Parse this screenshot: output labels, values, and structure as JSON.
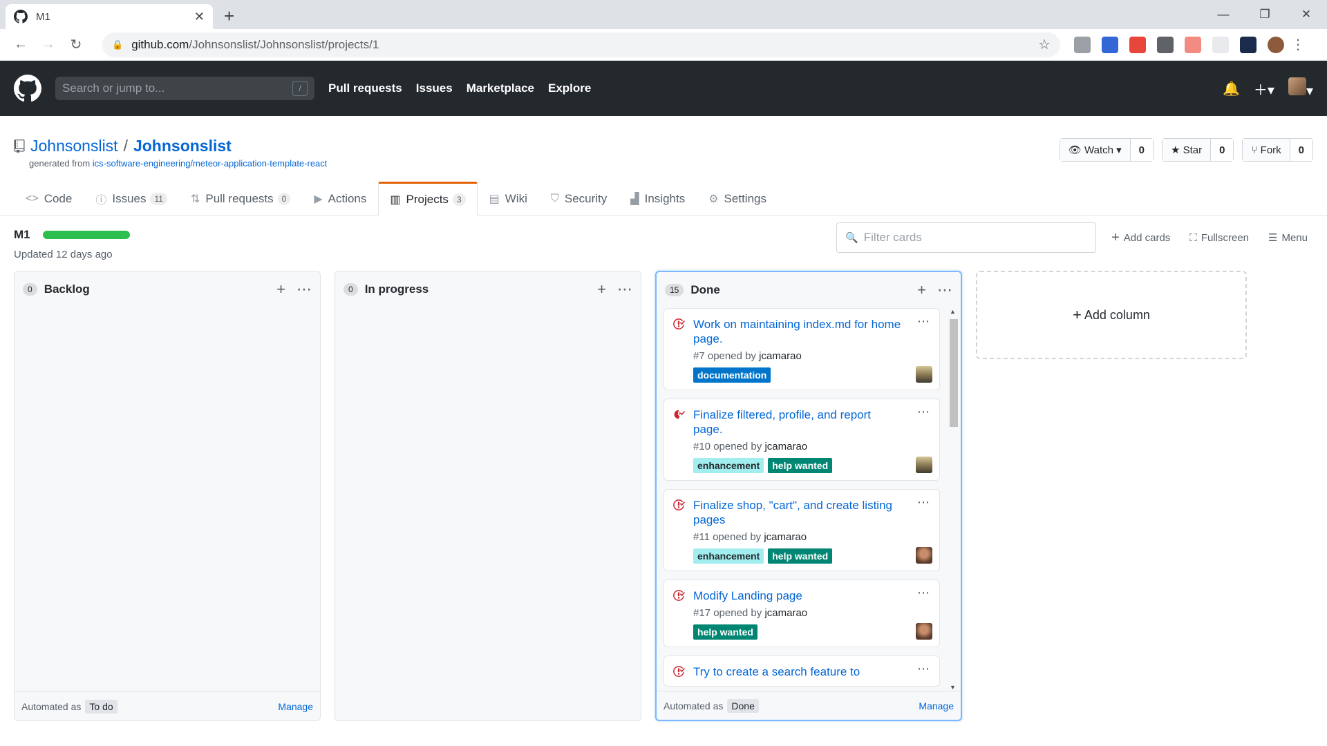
{
  "browser": {
    "tab_title": "M1",
    "url_host": "github.com",
    "url_path": "/Johnsonslist/Johnsonslist/projects/1"
  },
  "gh_header": {
    "search_placeholder": "Search or jump to...",
    "slash_key": "/",
    "nav": [
      "Pull requests",
      "Issues",
      "Marketplace",
      "Explore"
    ]
  },
  "repo": {
    "owner": "Johnsonslist",
    "separator": "/",
    "name": "Johnsonslist",
    "generated_prefix": "generated from",
    "generated_link": "ics-software-engineering/meteor-application-template-react",
    "watch_label": "Watch",
    "watch_count": "0",
    "star_label": "Star",
    "star_count": "0",
    "fork_label": "Fork",
    "fork_count": "0"
  },
  "reponav": {
    "code": "Code",
    "issues": "Issues",
    "issues_count": "11",
    "pulls": "Pull requests",
    "pulls_count": "0",
    "actions": "Actions",
    "projects": "Projects",
    "projects_count": "3",
    "wiki": "Wiki",
    "security": "Security",
    "insights": "Insights",
    "settings": "Settings"
  },
  "project": {
    "name": "M1",
    "progress_fraction": 1.0,
    "updated": "Updated 12 days ago",
    "filter_placeholder": "Filter cards",
    "add_cards": "Add cards",
    "fullscreen": "Fullscreen",
    "menu": "Menu",
    "add_column": "Add column"
  },
  "columns": {
    "backlog": {
      "count": "0",
      "name": "Backlog",
      "automated_as": "Automated as",
      "automation": "To do",
      "manage": "Manage"
    },
    "progress": {
      "count": "0",
      "name": "In progress"
    },
    "done": {
      "count": "15",
      "name": "Done",
      "automated_as": "Automated as",
      "automation": "Done",
      "manage": "Manage"
    }
  },
  "cards": [
    {
      "title": "Work on maintaining index.md for home page.",
      "number": "#7",
      "opened_by": "opened by",
      "user": "jcamarao",
      "labels": [
        "documentation"
      ]
    },
    {
      "title": "Finalize filtered, profile, and report page.",
      "number": "#10",
      "opened_by": "opened by",
      "user": "jcamarao",
      "labels": [
        "enhancement",
        "help wanted"
      ]
    },
    {
      "title": "Finalize shop, \"cart\", and create listing pages",
      "number": "#11",
      "opened_by": "opened by",
      "user": "jcamarao",
      "labels": [
        "enhancement",
        "help wanted"
      ]
    },
    {
      "title": "Modify Landing page",
      "number": "#17",
      "opened_by": "opened by",
      "user": "jcamarao",
      "labels": [
        "help wanted"
      ]
    },
    {
      "title": "Try to create a search feature to",
      "number": "",
      "opened_by": "",
      "user": "",
      "labels": []
    }
  ],
  "colors": {
    "accent_orange": "#e36209",
    "link_blue": "#0366d6",
    "progress_green": "#2cbe4e",
    "issue_closed_red": "#cb2431"
  }
}
